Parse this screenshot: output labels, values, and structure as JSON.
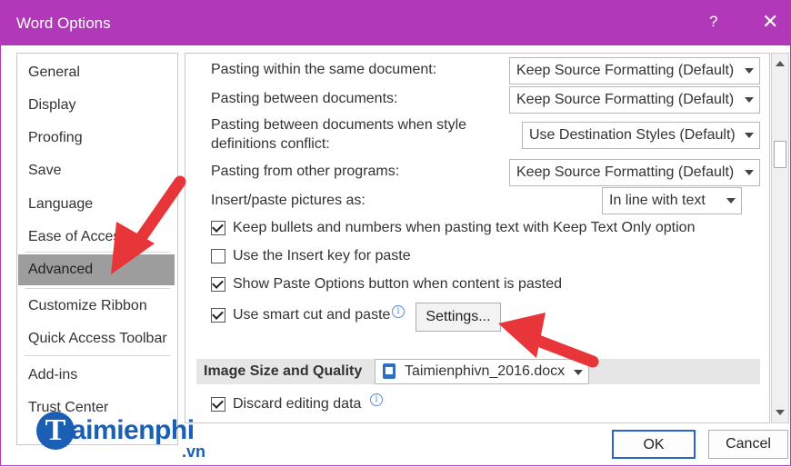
{
  "window": {
    "title": "Word Options",
    "help": "?",
    "close": "✕"
  },
  "nav": {
    "items": [
      {
        "label": "General"
      },
      {
        "label": "Display"
      },
      {
        "label": "Proofing"
      },
      {
        "label": "Save"
      },
      {
        "label": "Language"
      },
      {
        "label": "Ease of Access"
      },
      {
        "label": "Advanced",
        "selected": true
      },
      {
        "label": "Customize Ribbon"
      },
      {
        "label": "Quick Access Toolbar"
      },
      {
        "label": "Add-ins"
      },
      {
        "label": "Trust Center"
      }
    ]
  },
  "content": {
    "pasting_within": {
      "label": "Pasting within the same document:",
      "value": "Keep Source Formatting (Default)"
    },
    "pasting_between": {
      "label": "Pasting between documents:",
      "value": "Keep Source Formatting (Default)"
    },
    "pasting_conflict": {
      "label_line1": "Pasting between documents when style",
      "label_line2": "definitions conflict:",
      "value": "Use Destination Styles (Default)"
    },
    "pasting_other": {
      "label": "Pasting from other programs:",
      "value": "Keep Source Formatting (Default)"
    },
    "insert_pictures": {
      "label": "Insert/paste pictures as:",
      "value": "In line with text"
    },
    "checkboxes": [
      {
        "label": "Keep bullets and numbers when pasting text with Keep Text Only option",
        "checked": true
      },
      {
        "label": "Use the Insert key for paste",
        "checked": false
      },
      {
        "label": "Show Paste Options button when content is pasted",
        "checked": true
      },
      {
        "label": "Use smart cut and paste",
        "checked": true
      }
    ],
    "settings_button": "Settings...",
    "info_glyph": "i",
    "image_section": {
      "label": "Image Size and Quality",
      "document": "Taimienphivn_2016.docx"
    },
    "discard_editing": {
      "label": "Discard editing data",
      "checked": true
    }
  },
  "footer": {
    "ok": "OK",
    "cancel": "Cancel"
  },
  "watermark": {
    "letter": "T",
    "text": "aimienphi",
    "suffix": ".vn"
  },
  "colors": {
    "titlebar": "#b139b9",
    "arrow": "#e8353a",
    "logo": "#1a5fb4",
    "ok_border": "#2a64c4"
  }
}
